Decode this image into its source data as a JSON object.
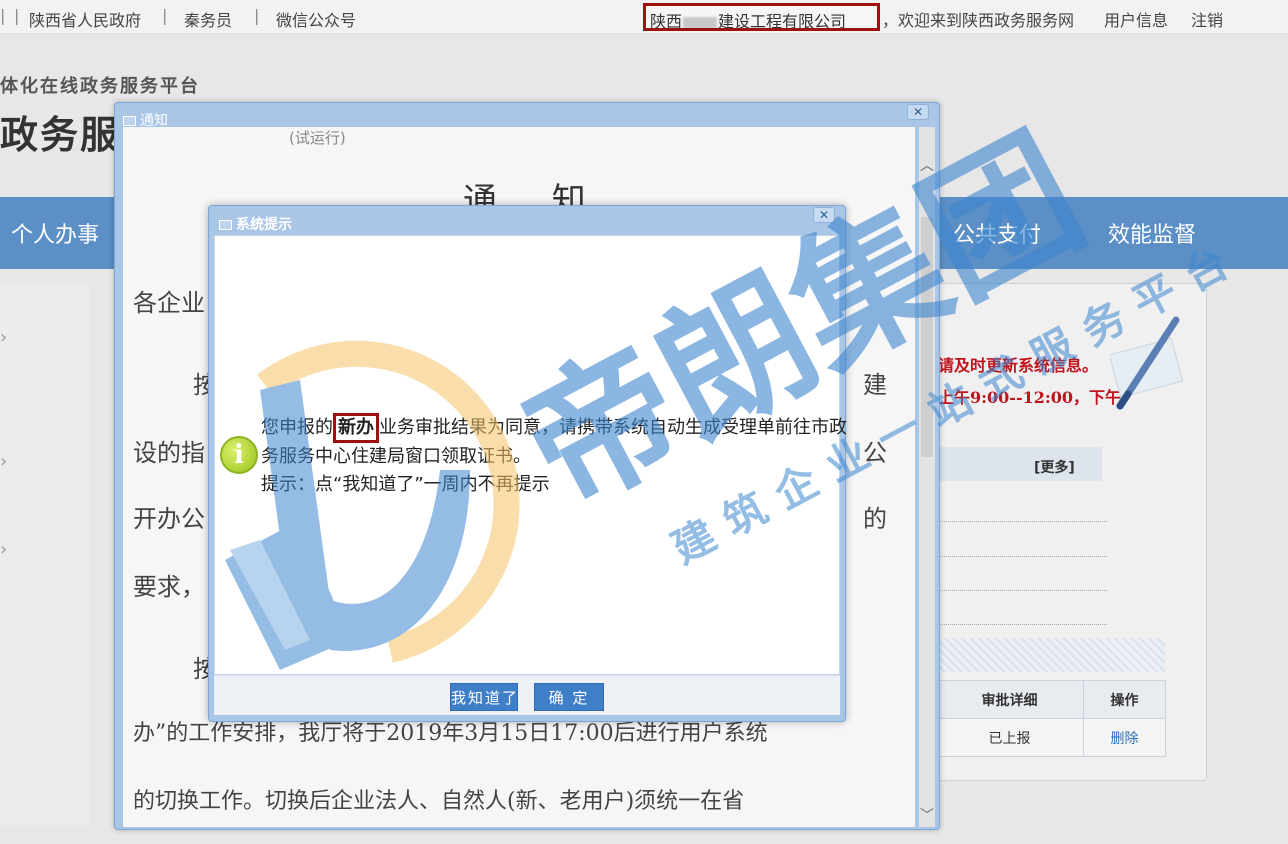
{
  "topbar": {
    "gov_link": "陕西省人民政府",
    "qin_link": "秦务员",
    "wechat_link": "微信公众号",
    "company_prefix": "陕西",
    "company_suffix": "建设工程有限公司",
    "welcome": "，欢迎来到陕西政务服务网",
    "user_info": "用户信息",
    "logout": "注销",
    "separator": "|"
  },
  "header": {
    "slogan": "体化在线政务服务平台",
    "title": "政务服务网"
  },
  "nav": {
    "personal": "个人办事",
    "payment": "公共支付",
    "supervision": "效能监督"
  },
  "side": {
    "notice_line1": "请及时更新系统信息。",
    "notice_line2": "上午9:00--12:00，下午",
    "more": "[更多]",
    "table_headers": [
      "审批详细",
      "操作"
    ],
    "table_row": [
      "已上报",
      "删除"
    ]
  },
  "notice_window": {
    "title": "通知",
    "status": "(试运行)",
    "heading": "通 知",
    "lines": [
      "各企业",
      "按",
      "设的指",
      "开办公",
      "要求，",
      "按",
      "办”的工作安排，我厅将于2019年3月15日17:00后进行用户系统",
      "的切换工作。切换后企业法人、自然人(新、老用户)须统一在省"
    ],
    "right_fragments": [
      "建",
      "公",
      "的"
    ]
  },
  "dialog": {
    "title": "系统提示",
    "message_part1": "您申报的",
    "message_highlight": "新办",
    "message_part2": "业务审批结果为同意，请携带系统自动生成受理单前往市政务服务中心住建局窗口领取证书。",
    "hint": "提示：点“我知道了”一周内不再提示",
    "btn_know": "我知道了",
    "btn_ok": "确 定"
  },
  "watermark": {
    "brand": "帝朗集团",
    "tagline": "建筑企业一站式服务平台"
  },
  "colors": {
    "nav_bg": "#5b8fc6",
    "highlight_border": "#a01010",
    "button": "#3f7fc8",
    "watermark": "#3d86cf"
  }
}
